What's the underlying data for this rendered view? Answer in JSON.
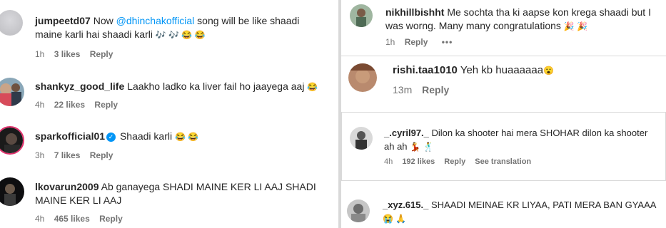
{
  "left": {
    "comments": [
      {
        "username": "jumpeetd07",
        "prefix": "Now ",
        "mention": "@dhinchakofficial",
        "text_line1": " song will be like shaadi",
        "text_line2": "maine karli hai shaadi karli",
        "emojis": "🎶 🎶 😂 😂",
        "time": "1h",
        "likes": "3 likes",
        "reply": "Reply"
      },
      {
        "username": "shankyz_good_life",
        "text": "Laakho ladko ka liver fail ho jaayega aaj",
        "emojis": "😂",
        "time": "4h",
        "likes": "22 likes",
        "reply": "Reply"
      },
      {
        "username": "sparkofficial01",
        "text": "Shaadi karli",
        "emojis": "😂 😂",
        "time": "3h",
        "likes": "7 likes",
        "reply": "Reply"
      },
      {
        "username": "lkovarun2009",
        "text_line1": "Ab ganayega SHADI MAINE KER LI AAJ SHADI",
        "text_line2": "MAINE KER LI AAJ",
        "time": "4h",
        "likes": "465 likes",
        "reply": "Reply"
      }
    ]
  },
  "right": {
    "comments": [
      {
        "username": "nikhillbishht",
        "text_line1": "Me sochta tha ki aapse kon krega shaadi but I",
        "text_line2": "was worng. Many many congratulations",
        "emojis": "🎉 🎉",
        "time": "1h",
        "reply": "Reply",
        "more": "•••"
      },
      {
        "username": "rishi.taa1010",
        "text": "Yeh kb huaaaaaa",
        "emojis": "😮",
        "time": "13m",
        "reply": "Reply"
      },
      {
        "username": "_.cyril97._",
        "text_line1": "Dilon ka shooter hai mera SHOHAR dilon ka shooter",
        "text_line2": "ah ah",
        "emojis": "💃 🕺",
        "time": "4h",
        "likes": "192 likes",
        "reply": "Reply",
        "translate": "See translation"
      },
      {
        "username": "_xyz.615._",
        "text": "SHAADI MEINAE KR LIYAA, PATI MERA BAN GYAAA",
        "emojis": "😭 🙏"
      }
    ]
  },
  "icons": {
    "verified": "verified-badge-icon",
    "more": "more-options-icon"
  },
  "colors": {
    "text": "#262626",
    "meta": "#737373",
    "mention": "#0095f6",
    "divider": "#d9d9d9"
  }
}
